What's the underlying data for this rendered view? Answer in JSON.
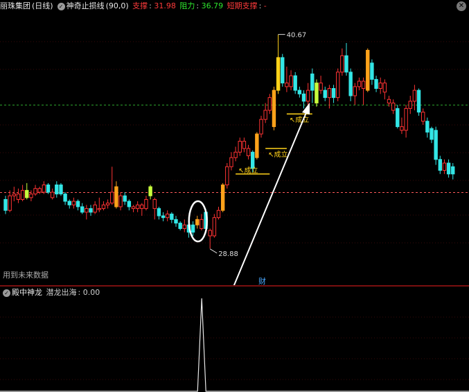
{
  "header": {
    "stock_name": "丽珠集团",
    "period": "(日线)",
    "indicator_name": "神奇止损线",
    "indicator_params": "(90,0)",
    "support_label": "支撑",
    "support_value": "31.98",
    "resistance_label": "阻力",
    "resistance_value": "36.79",
    "short_support_label": "短期支撑",
    "short_support_value": "-"
  },
  "sub_header": {
    "indicator_name": "殿中神龙",
    "output_label": "潜龙出海",
    "output_value": "0.00"
  },
  "annotations": {
    "high_price": "40.67",
    "low_price": "28.88",
    "established_1": "成立",
    "established_2": "成立",
    "established_3": "成立",
    "finance_marker": "财",
    "future_data_note": "用到未来数据"
  },
  "colors": {
    "up": "#ff3333",
    "down": "#33e6e6",
    "yellow": "#ffd21a",
    "orange": "#ffa21a",
    "lime": "#c8ff3c",
    "green_line": "#2ea82e",
    "red_line": "#ff5a5a"
  },
  "chart_data": [
    {
      "type": "candlestick",
      "price_range": [
        27.5,
        41.8
      ],
      "support": 31.98,
      "resistance": 36.79,
      "high_mark": 40.67,
      "low_mark": 28.88,
      "candles": [
        {
          "o": 31.6,
          "c": 31.0,
          "h": 31.8,
          "l": 30.8,
          "k": "down"
        },
        {
          "o": 31.0,
          "c": 31.8,
          "h": 32.1,
          "l": 30.9,
          "k": "up"
        },
        {
          "o": 31.8,
          "c": 31.9,
          "h": 32.3,
          "l": 31.5,
          "k": "up"
        },
        {
          "o": 31.9,
          "c": 31.6,
          "h": 32.2,
          "l": 31.4,
          "k": "up"
        },
        {
          "o": 31.6,
          "c": 32.1,
          "h": 32.4,
          "l": 31.5,
          "k": "up"
        },
        {
          "o": 32.1,
          "c": 31.7,
          "h": 32.5,
          "l": 31.6,
          "k": "lime"
        },
        {
          "o": 31.7,
          "c": 31.9,
          "h": 32.1,
          "l": 31.5,
          "k": "up"
        },
        {
          "o": 31.9,
          "c": 32.2,
          "h": 32.4,
          "l": 31.8,
          "k": "up"
        },
        {
          "o": 32.2,
          "c": 32.0,
          "h": 32.3,
          "l": 31.9,
          "k": "up"
        },
        {
          "o": 32.0,
          "c": 32.4,
          "h": 32.6,
          "l": 31.9,
          "k": "up"
        },
        {
          "o": 32.4,
          "c": 32.0,
          "h": 32.5,
          "l": 31.9,
          "k": "down"
        },
        {
          "o": 32.0,
          "c": 31.7,
          "h": 32.2,
          "l": 31.6,
          "k": "up"
        },
        {
          "o": 31.9,
          "c": 32.4,
          "h": 32.6,
          "l": 31.7,
          "k": "down"
        },
        {
          "o": 32.4,
          "c": 31.9,
          "h": 32.5,
          "l": 31.8,
          "k": "down"
        },
        {
          "o": 31.9,
          "c": 31.5,
          "h": 32.0,
          "l": 31.3,
          "k": "down"
        },
        {
          "o": 31.5,
          "c": 31.3,
          "h": 31.6,
          "l": 31.1,
          "k": "down"
        },
        {
          "o": 31.3,
          "c": 31.5,
          "h": 31.7,
          "l": 31.1,
          "k": "up"
        },
        {
          "o": 31.5,
          "c": 31.2,
          "h": 31.6,
          "l": 31.0,
          "k": "down"
        },
        {
          "o": 31.2,
          "c": 30.9,
          "h": 31.4,
          "l": 30.8,
          "k": "down"
        },
        {
          "o": 30.9,
          "c": 31.1,
          "h": 31.3,
          "l": 30.5,
          "k": "up"
        },
        {
          "o": 31.1,
          "c": 30.9,
          "h": 31.3,
          "l": 30.7,
          "k": "down"
        },
        {
          "o": 30.9,
          "c": 31.3,
          "h": 31.5,
          "l": 30.8,
          "k": "up"
        },
        {
          "o": 31.1,
          "c": 31.1,
          "h": 31.7,
          "l": 30.9,
          "k": "up"
        },
        {
          "o": 31.1,
          "c": 31.3,
          "h": 31.5,
          "l": 31.0,
          "k": "up"
        },
        {
          "o": 31.3,
          "c": 31.4,
          "h": 31.6,
          "l": 31.1,
          "k": "up"
        },
        {
          "o": 31.4,
          "c": 32.0,
          "h": 33.4,
          "l": 31.3,
          "k": "up"
        },
        {
          "o": 32.3,
          "c": 31.2,
          "h": 32.6,
          "l": 31.1,
          "k": "orange"
        },
        {
          "o": 31.2,
          "c": 31.8,
          "h": 32.0,
          "l": 31.0,
          "k": "up"
        },
        {
          "o": 31.8,
          "c": 31.5,
          "h": 32.0,
          "l": 31.3,
          "k": "down"
        },
        {
          "o": 31.5,
          "c": 31.2,
          "h": 31.6,
          "l": 31.0,
          "k": "down"
        },
        {
          "o": 31.2,
          "c": 31.1,
          "h": 31.3,
          "l": 30.9,
          "k": "up"
        },
        {
          "o": 31.1,
          "c": 31.3,
          "h": 31.5,
          "l": 30.9,
          "k": "up"
        },
        {
          "o": 31.3,
          "c": 31.1,
          "h": 31.4,
          "l": 30.7,
          "k": "up"
        },
        {
          "o": 31.1,
          "c": 31.6,
          "h": 31.8,
          "l": 31.0,
          "k": "up"
        },
        {
          "o": 31.8,
          "c": 32.3,
          "h": 32.4,
          "l": 31.6,
          "k": "lime"
        },
        {
          "o": 31.6,
          "c": 31.1,
          "h": 31.7,
          "l": 30.5,
          "k": "up"
        },
        {
          "o": 31.1,
          "c": 30.7,
          "h": 31.2,
          "l": 30.5,
          "k": "down"
        },
        {
          "o": 30.7,
          "c": 30.6,
          "h": 30.9,
          "l": 30.4,
          "k": "down"
        },
        {
          "o": 30.6,
          "c": 30.8,
          "h": 31.0,
          "l": 30.4,
          "k": "up"
        },
        {
          "o": 30.8,
          "c": 30.5,
          "h": 30.9,
          "l": 30.3,
          "k": "down"
        },
        {
          "o": 30.5,
          "c": 30.3,
          "h": 30.7,
          "l": 30.1,
          "k": "down"
        },
        {
          "o": 30.3,
          "c": 30.0,
          "h": 30.4,
          "l": 29.9,
          "k": "down"
        },
        {
          "o": 30.0,
          "c": 30.2,
          "h": 30.5,
          "l": 29.8,
          "k": "up"
        },
        {
          "o": 30.2,
          "c": 29.8,
          "h": 30.3,
          "l": 29.5,
          "k": "down"
        },
        {
          "o": 29.8,
          "c": 30.2,
          "h": 30.4,
          "l": 29.6,
          "k": "down"
        },
        {
          "o": 30.2,
          "c": 30.5,
          "h": 30.7,
          "l": 30.0,
          "k": "orange"
        },
        {
          "o": 30.5,
          "c": 30.0,
          "h": 30.8,
          "l": 29.9,
          "k": "up"
        },
        {
          "o": 30.0,
          "c": 30.9,
          "h": 31.1,
          "l": 29.8,
          "k": "down"
        },
        {
          "o": 29.9,
          "c": 29.6,
          "h": 30.0,
          "l": 28.9,
          "k": "up"
        },
        {
          "o": 29.6,
          "c": 30.6,
          "h": 30.8,
          "l": 29.5,
          "k": "up"
        },
        {
          "o": 30.6,
          "c": 31.0,
          "h": 31.2,
          "l": 30.5,
          "k": "up"
        },
        {
          "o": 31.0,
          "c": 32.4,
          "h": 32.5,
          "l": 30.9,
          "k": "orange"
        },
        {
          "o": 32.4,
          "c": 33.4,
          "h": 33.6,
          "l": 32.2,
          "k": "up"
        },
        {
          "o": 33.4,
          "c": 33.9,
          "h": 34.2,
          "l": 33.2,
          "k": "up"
        },
        {
          "o": 33.9,
          "c": 34.2,
          "h": 34.5,
          "l": 33.7,
          "k": "up"
        },
        {
          "o": 34.2,
          "c": 34.8,
          "h": 35.0,
          "l": 34.0,
          "k": "up"
        },
        {
          "o": 34.8,
          "c": 34.4,
          "h": 35.0,
          "l": 34.2,
          "k": "up"
        },
        {
          "o": 34.4,
          "c": 34.0,
          "h": 34.6,
          "l": 33.8,
          "k": "up"
        },
        {
          "o": 34.2,
          "c": 33.3,
          "h": 34.3,
          "l": 33.1,
          "k": "down"
        },
        {
          "o": 33.9,
          "c": 35.2,
          "h": 35.3,
          "l": 33.8,
          "k": "orange"
        },
        {
          "o": 35.2,
          "c": 36.0,
          "h": 36.2,
          "l": 35.0,
          "k": "up"
        },
        {
          "o": 36.0,
          "c": 36.5,
          "h": 36.9,
          "l": 35.8,
          "k": "up"
        },
        {
          "o": 36.5,
          "c": 37.2,
          "h": 37.4,
          "l": 36.3,
          "k": "up"
        },
        {
          "o": 35.6,
          "c": 37.6,
          "h": 37.8,
          "l": 35.4,
          "k": "orange"
        },
        {
          "o": 37.6,
          "c": 39.4,
          "h": 40.67,
          "l": 37.4,
          "k": "yellow"
        },
        {
          "o": 39.4,
          "c": 38.0,
          "h": 39.6,
          "l": 37.8,
          "k": "down"
        },
        {
          "o": 38.0,
          "c": 37.8,
          "h": 38.9,
          "l": 37.5,
          "k": "up"
        },
        {
          "o": 37.8,
          "c": 38.4,
          "h": 38.7,
          "l": 37.6,
          "k": "up"
        },
        {
          "o": 38.4,
          "c": 37.6,
          "h": 38.6,
          "l": 37.4,
          "k": "down"
        },
        {
          "o": 37.6,
          "c": 37.4,
          "h": 37.8,
          "l": 37.2,
          "k": "down"
        },
        {
          "o": 37.4,
          "c": 37.0,
          "h": 37.6,
          "l": 36.6,
          "k": "down"
        },
        {
          "o": 37.0,
          "c": 37.6,
          "h": 38.0,
          "l": 36.8,
          "k": "up"
        },
        {
          "o": 37.6,
          "c": 38.5,
          "h": 38.8,
          "l": 36.9,
          "k": "down"
        },
        {
          "o": 36.9,
          "c": 38.0,
          "h": 38.2,
          "l": 36.7,
          "k": "lime"
        },
        {
          "o": 38.0,
          "c": 37.6,
          "h": 38.4,
          "l": 37.4,
          "k": "up"
        },
        {
          "o": 37.6,
          "c": 37.2,
          "h": 37.8,
          "l": 37.0,
          "k": "down"
        },
        {
          "o": 37.2,
          "c": 37.7,
          "h": 37.9,
          "l": 36.6,
          "k": "up"
        },
        {
          "o": 37.7,
          "c": 37.2,
          "h": 37.9,
          "l": 36.9,
          "k": "down"
        },
        {
          "o": 37.2,
          "c": 38.6,
          "h": 38.8,
          "l": 37.0,
          "k": "up"
        },
        {
          "o": 38.6,
          "c": 39.5,
          "h": 39.9,
          "l": 38.4,
          "k": "up"
        },
        {
          "o": 39.5,
          "c": 38.6,
          "h": 40.2,
          "l": 38.4,
          "k": "down"
        },
        {
          "o": 38.6,
          "c": 37.3,
          "h": 38.8,
          "l": 37.0,
          "k": "down"
        },
        {
          "o": 37.3,
          "c": 37.8,
          "h": 38.0,
          "l": 36.8,
          "k": "up"
        },
        {
          "o": 37.8,
          "c": 38.1,
          "h": 38.3,
          "l": 37.6,
          "k": "up"
        },
        {
          "o": 38.1,
          "c": 37.7,
          "h": 38.3,
          "l": 36.8,
          "k": "up"
        },
        {
          "o": 37.6,
          "c": 39.8,
          "h": 39.9,
          "l": 37.5,
          "k": "orange"
        },
        {
          "o": 39.1,
          "c": 38.2,
          "h": 39.3,
          "l": 37.9,
          "k": "down"
        },
        {
          "o": 38.2,
          "c": 37.7,
          "h": 38.4,
          "l": 37.5,
          "k": "down"
        },
        {
          "o": 37.7,
          "c": 38.0,
          "h": 38.3,
          "l": 37.4,
          "k": "up"
        },
        {
          "o": 38.0,
          "c": 37.5,
          "h": 38.2,
          "l": 37.1,
          "k": "up"
        },
        {
          "o": 37.1,
          "c": 36.9,
          "h": 37.3,
          "l": 36.7,
          "k": "up"
        },
        {
          "o": 36.9,
          "c": 36.5,
          "h": 37.1,
          "l": 36.3,
          "k": "up"
        },
        {
          "o": 36.6,
          "c": 35.6,
          "h": 36.8,
          "l": 35.5,
          "k": "down"
        },
        {
          "o": 35.6,
          "c": 35.4,
          "h": 36.1,
          "l": 35.2,
          "k": "up"
        },
        {
          "o": 35.4,
          "c": 36.6,
          "h": 36.8,
          "l": 35.0,
          "k": "up"
        },
        {
          "o": 36.6,
          "c": 37.0,
          "h": 37.3,
          "l": 36.3,
          "k": "up"
        },
        {
          "o": 37.0,
          "c": 37.6,
          "h": 37.9,
          "l": 36.5,
          "k": "up"
        },
        {
          "o": 37.6,
          "c": 36.4,
          "h": 37.7,
          "l": 36.2,
          "k": "down"
        },
        {
          "o": 36.4,
          "c": 35.9,
          "h": 36.6,
          "l": 35.7,
          "k": "up"
        },
        {
          "o": 35.9,
          "c": 35.3,
          "h": 36.1,
          "l": 35.0,
          "k": "down"
        },
        {
          "o": 35.5,
          "c": 34.9,
          "h": 35.6,
          "l": 34.7,
          "k": "down"
        },
        {
          "o": 35.4,
          "c": 33.8,
          "h": 35.6,
          "l": 33.5,
          "k": "down"
        },
        {
          "o": 33.8,
          "c": 33.2,
          "h": 34.0,
          "l": 33.0,
          "k": "down"
        },
        {
          "o": 33.2,
          "c": 33.6,
          "h": 33.8,
          "l": 33.0,
          "k": "up"
        },
        {
          "o": 33.6,
          "c": 33.0,
          "h": 33.8,
          "l": 32.8,
          "k": "down"
        },
        {
          "o": 33.0,
          "c": 33.4,
          "h": 33.6,
          "l": 32.7,
          "k": "down"
        }
      ]
    },
    {
      "type": "line",
      "output_value": 0.0,
      "spike_value": 1.0,
      "spike_index": 48,
      "range": [
        0,
        1.0
      ]
    }
  ]
}
